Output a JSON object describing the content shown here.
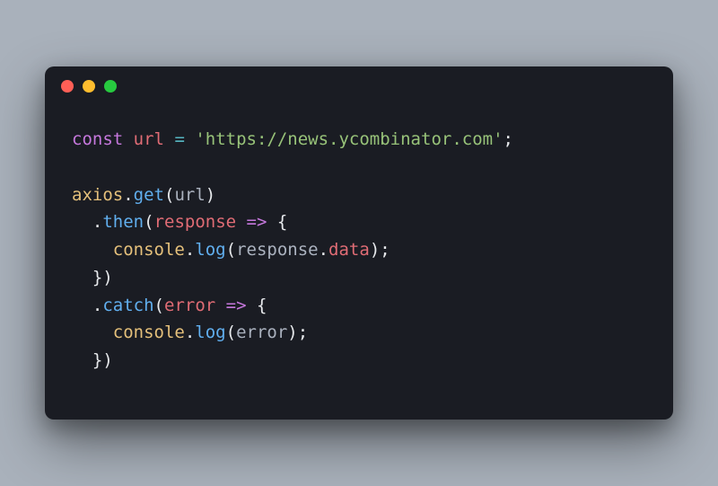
{
  "traffic_lights": {
    "red": "#ff5f56",
    "yellow": "#ffbd2e",
    "green": "#27c93f"
  },
  "code": {
    "line1": {
      "kw": "const",
      "sp1": " ",
      "var": "url",
      "sp2": " ",
      "op": "=",
      "sp3": " ",
      "str": "'https://news.ycombinator.com'",
      "semi": ";"
    },
    "line2": "",
    "line3": {
      "obj": "axios",
      "dot": ".",
      "meth": "get",
      "po": "(",
      "arg": "url",
      "pc": ")"
    },
    "line4": {
      "indent": "  ",
      "dot": ".",
      "meth": "then",
      "po": "(",
      "param": "response",
      "sp": " ",
      "arrow": "=>",
      "sp2": " ",
      "brace": "{"
    },
    "line5": {
      "indent": "    ",
      "obj": "console",
      "dot": ".",
      "meth": "log",
      "po": "(",
      "arg": "response",
      "dot2": ".",
      "prop": "data",
      "pc": ")",
      "semi": ";"
    },
    "line6": {
      "indent": "  ",
      "brace": "}",
      "pc": ")"
    },
    "line7": {
      "indent": "  ",
      "dot": ".",
      "meth": "catch",
      "po": "(",
      "param": "error",
      "sp": " ",
      "arrow": "=>",
      "sp2": " ",
      "brace": "{"
    },
    "line8": {
      "indent": "    ",
      "obj": "console",
      "dot": ".",
      "meth": "log",
      "po": "(",
      "arg": "error",
      "pc": ")",
      "semi": ";"
    },
    "line9": {
      "indent": "  ",
      "brace": "}",
      "pc": ")"
    }
  }
}
